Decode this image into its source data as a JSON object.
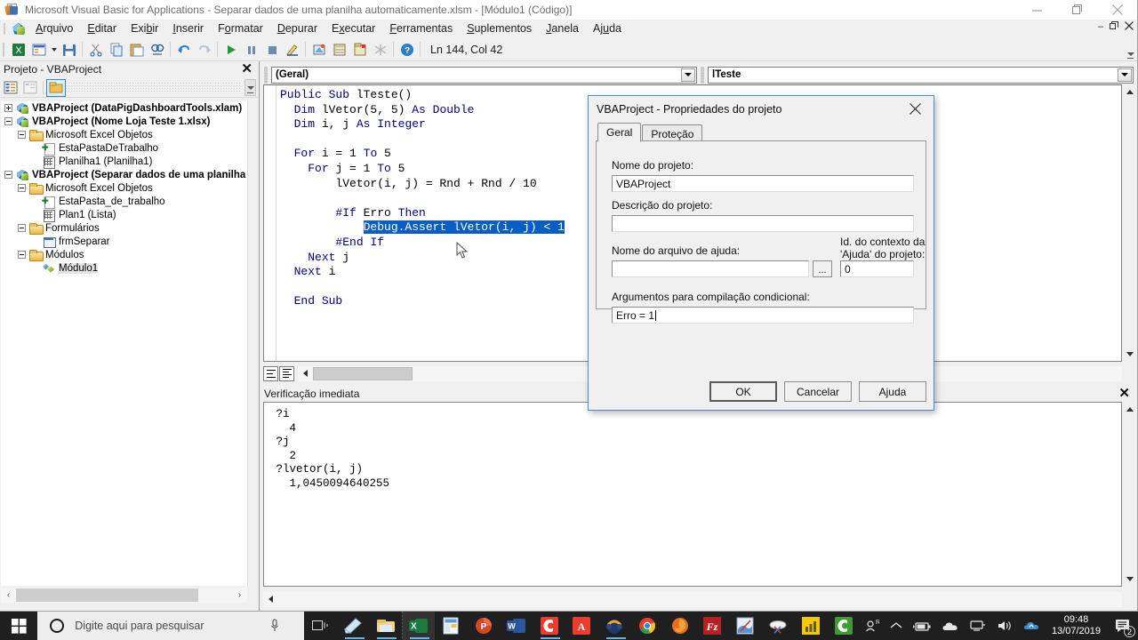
{
  "window": {
    "title": "Microsoft Visual Basic for Applications - Separar dados de uma planilha automaticamente.xlsm - [Módulo1 (Código)]",
    "icon": "vba-app-icon",
    "minimize_label": "—",
    "restore_label": "❐",
    "close_label": "✕"
  },
  "menubar": {
    "items": [
      {
        "label": "Arquivo",
        "accel": "A"
      },
      {
        "label": "Editar",
        "accel": "E"
      },
      {
        "label": "Exibir",
        "accel": "b"
      },
      {
        "label": "Inserir",
        "accel": "I"
      },
      {
        "label": "Formatar",
        "accel": "o"
      },
      {
        "label": "Depurar",
        "accel": "D"
      },
      {
        "label": "Executar",
        "accel": "x"
      },
      {
        "label": "Ferramentas",
        "accel": "F"
      },
      {
        "label": "Suplementos",
        "accel": "S"
      },
      {
        "label": "Janela",
        "accel": "J"
      },
      {
        "label": "Ajuda",
        "accel": "u"
      }
    ],
    "child_minimize": "–",
    "child_restore": "❐",
    "child_close": "✕"
  },
  "toolbar": {
    "status_text": "Ln 144, Col 42",
    "buttons": [
      "view-excel-icon",
      "insert-userform-icon",
      "save-icon",
      "cut-icon",
      "copy-icon",
      "paste-icon",
      "find-icon",
      "undo-icon",
      "redo-icon",
      "run-icon",
      "break-icon",
      "reset-icon",
      "design-mode-icon",
      "project-explorer-icon",
      "properties-window-icon",
      "object-browser-icon",
      "toolbox-icon",
      "help-icon"
    ]
  },
  "project_explorer": {
    "title": "Projeto - VBAProject",
    "close_label": "✕",
    "toolbar_buttons": [
      "view-code-icon",
      "view-object-icon",
      "toggle-folders-icon"
    ],
    "tree": [
      {
        "level": 0,
        "label": "VBAProject (DataPigDashboardTools.xlam)",
        "icon": "vbaproject-icon",
        "expander": "plus",
        "bold": true
      },
      {
        "level": 0,
        "label": "VBAProject (Nome Loja Teste 1.xlsx)",
        "icon": "vbaproject-icon",
        "expander": "minus",
        "bold": true
      },
      {
        "level": 1,
        "label": "Microsoft Excel Objetos",
        "icon": "folder-icon",
        "expander": "minus",
        "bold": false
      },
      {
        "level": 2,
        "label": "EstaPastaDeTrabalho",
        "icon": "workbook-icon",
        "expander": "none",
        "bold": false
      },
      {
        "level": 2,
        "label": "Planilha1 (Planilha1)",
        "icon": "worksheet-icon",
        "expander": "none",
        "bold": false
      },
      {
        "level": 0,
        "label": "VBAProject (Separar dados de uma planilha aut",
        "icon": "vbaproject-icon",
        "expander": "minus",
        "bold": true
      },
      {
        "level": 1,
        "label": "Microsoft Excel Objetos",
        "icon": "folder-icon",
        "expander": "minus",
        "bold": false
      },
      {
        "level": 2,
        "label": "EstaPasta_de_trabalho",
        "icon": "workbook-icon",
        "expander": "none",
        "bold": false
      },
      {
        "level": 2,
        "label": "Plan1 (Lista)",
        "icon": "worksheet-icon",
        "expander": "none",
        "bold": false
      },
      {
        "level": 1,
        "label": "Formulários",
        "icon": "folder-icon",
        "expander": "minus",
        "bold": false
      },
      {
        "level": 2,
        "label": "frmSeparar",
        "icon": "userform-icon",
        "expander": "none",
        "bold": false
      },
      {
        "level": 1,
        "label": "Módulos",
        "icon": "folder-icon",
        "expander": "minus",
        "bold": false
      },
      {
        "level": 2,
        "label": "Módulo1",
        "icon": "module-icon",
        "expander": "none",
        "bold": false,
        "selected": true
      }
    ]
  },
  "code_window": {
    "object_combo": "(Geral)",
    "proc_combo": "lTeste",
    "lines": [
      {
        "segments": [
          {
            "t": "Public Sub ",
            "c": "kw"
          },
          {
            "t": "lTeste()",
            "c": ""
          }
        ]
      },
      {
        "segments": [
          {
            "t": "  ",
            "c": ""
          },
          {
            "t": "Dim ",
            "c": "kw"
          },
          {
            "t": "lVetor(5, 5) ",
            "c": ""
          },
          {
            "t": "As Double",
            "c": "kw"
          }
        ]
      },
      {
        "segments": [
          {
            "t": "  ",
            "c": ""
          },
          {
            "t": "Dim ",
            "c": "kw"
          },
          {
            "t": "i, j ",
            "c": ""
          },
          {
            "t": "As Integer",
            "c": "kw"
          }
        ]
      },
      {
        "segments": [
          {
            "t": "",
            "c": ""
          }
        ]
      },
      {
        "segments": [
          {
            "t": "  ",
            "c": ""
          },
          {
            "t": "For ",
            "c": "kw"
          },
          {
            "t": "i = 1 ",
            "c": ""
          },
          {
            "t": "To ",
            "c": "kw"
          },
          {
            "t": "5",
            "c": ""
          }
        ]
      },
      {
        "segments": [
          {
            "t": "    ",
            "c": ""
          },
          {
            "t": "For ",
            "c": "kw"
          },
          {
            "t": "j = 1 ",
            "c": ""
          },
          {
            "t": "To ",
            "c": "kw"
          },
          {
            "t": "5",
            "c": ""
          }
        ]
      },
      {
        "segments": [
          {
            "t": "        lVetor(i, j) = Rnd + Rnd / 10",
            "c": ""
          }
        ]
      },
      {
        "segments": [
          {
            "t": "",
            "c": ""
          }
        ]
      },
      {
        "segments": [
          {
            "t": "        ",
            "c": ""
          },
          {
            "t": "#If ",
            "c": "kw"
          },
          {
            "t": "Erro ",
            "c": ""
          },
          {
            "t": "Then",
            "c": "kw"
          }
        ]
      },
      {
        "segments": [
          {
            "t": "            ",
            "c": ""
          },
          {
            "t": "Debug.Assert lVetor(i, j) < 1",
            "c": "sel"
          }
        ]
      },
      {
        "segments": [
          {
            "t": "        ",
            "c": ""
          },
          {
            "t": "#End If",
            "c": "kw"
          }
        ]
      },
      {
        "segments": [
          {
            "t": "    ",
            "c": ""
          },
          {
            "t": "Next ",
            "c": "kw"
          },
          {
            "t": "j",
            "c": ""
          }
        ]
      },
      {
        "segments": [
          {
            "t": "  ",
            "c": ""
          },
          {
            "t": "Next ",
            "c": "kw"
          },
          {
            "t": "i",
            "c": ""
          }
        ]
      },
      {
        "segments": [
          {
            "t": "",
            "c": ""
          }
        ]
      },
      {
        "segments": [
          {
            "t": "  ",
            "c": ""
          },
          {
            "t": "End Sub",
            "c": "kw"
          }
        ]
      }
    ]
  },
  "immediate_window": {
    "title": "Verificação imediata",
    "close_label": "✕",
    "content": " ?i\n   4\n ?j\n   2\n ?lvetor(i, j)\n   1,0450094640255"
  },
  "dialog": {
    "title": "VBAProject - Propriedades do projeto",
    "close_label": "✕",
    "tabs": [
      {
        "label": "Geral",
        "active": true
      },
      {
        "label": "Proteção",
        "active": false
      }
    ],
    "fields": {
      "project_name_label": "Nome do projeto:",
      "project_name_value": "VBAProject",
      "project_desc_label": "Descrição do projeto:",
      "project_desc_value": "",
      "help_file_label": "Nome do arquivo de ajuda:",
      "help_file_value": "",
      "browse_label": "...",
      "help_context_label_line1": "Id. do contexto da",
      "help_context_label_line2": "'Ajuda' do projeto:",
      "help_context_value": "0",
      "cond_compile_label": "Argumentos para compilação condicional:",
      "cond_compile_value": "Erro = 1"
    },
    "buttons": {
      "ok": "OK",
      "cancel": "Cancelar",
      "help": "Ajuda"
    }
  },
  "taskbar": {
    "start_label": "start-icon",
    "search_placeholder": "Digite aqui para pesquisar",
    "cortana_icon": "cortana-circle-icon",
    "mic_icon": "microphone-icon",
    "apps": [
      "task-view-icon",
      "sticky-notes-icon",
      "file-explorer-icon",
      "excel-icon",
      "publisher-icon",
      "powerpoint-icon",
      "word-icon",
      "camtasia-icon",
      "acrobat-icon",
      "audacity-icon",
      "chrome-icon",
      "firefox-icon",
      "filezilla-icon",
      "paint-icon",
      "snipping-tool-icon",
      "power-bi-icon",
      "camtasia-studio-icon"
    ],
    "tray": {
      "people_icon": "people-icon",
      "chevron_icon": "show-hidden-icons-icon",
      "battery_icon": "battery-icon",
      "onedrive_icon": "onedrive-icon",
      "network_icon": "network-icon",
      "volume_icon": "volume-icon",
      "update_icon": "windows-update-icon",
      "time": "09:48",
      "date": "13/07/2019",
      "notification_count": "2"
    }
  }
}
